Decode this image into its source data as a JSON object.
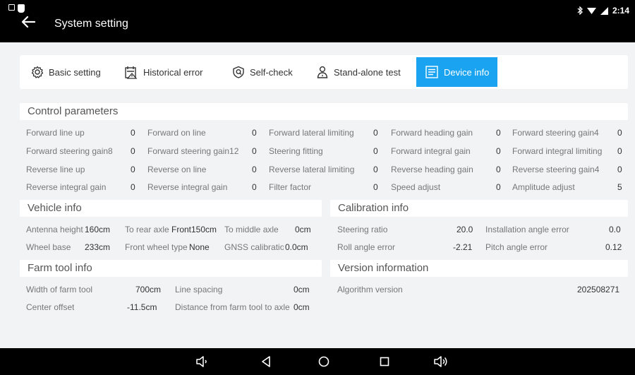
{
  "header": {
    "title": "System setting"
  },
  "status": {
    "time": "2:14"
  },
  "tabs": [
    {
      "label": "Basic setting",
      "icon": "gear-icon"
    },
    {
      "label": "Historical error",
      "icon": "error-history-icon"
    },
    {
      "label": "Self-check",
      "icon": "self-check-icon"
    },
    {
      "label": "Stand-alone test",
      "icon": "person-test-icon"
    },
    {
      "label": "Device info",
      "icon": "device-info-icon",
      "active": true
    }
  ],
  "control": {
    "title": "Control parameters",
    "rows": [
      [
        {
          "label": "Forward line up",
          "value": "0"
        },
        {
          "label": "Forward on line",
          "value": "0"
        },
        {
          "label": "Forward lateral limiting",
          "value": "0"
        },
        {
          "label": "Forward heading gain",
          "value": "0"
        },
        {
          "label": "Forward steering gain4",
          "value": "0"
        }
      ],
      [
        {
          "label": "Forward steering gain8",
          "value": "0"
        },
        {
          "label": "Forward steering gain12",
          "value": "0"
        },
        {
          "label": "Steering fitting",
          "value": "0"
        },
        {
          "label": "Forward integral gain",
          "value": "0"
        },
        {
          "label": "Forward integral limiting",
          "value": "0"
        }
      ],
      [
        {
          "label": "Reverse line up",
          "value": "0"
        },
        {
          "label": "Reverse on line",
          "value": "0"
        },
        {
          "label": "Reverse lateral limiting",
          "value": "0"
        },
        {
          "label": "Reverse heading gain",
          "value": "0"
        },
        {
          "label": "Reverse steering gain4",
          "value": "0"
        }
      ],
      [
        {
          "label": "Reverse integral gain",
          "value": "0"
        },
        {
          "label": "Reverse integral gain",
          "value": "0"
        },
        {
          "label": "Filter factor",
          "value": "0"
        },
        {
          "label": "Speed adjust",
          "value": "0"
        },
        {
          "label": "Amplitude adjust",
          "value": "5"
        }
      ]
    ]
  },
  "vehicle": {
    "title": "Vehicle info",
    "rows": [
      [
        {
          "label": "Antenna height",
          "value": "160cm"
        },
        {
          "label": "To rear axle",
          "value": "Front150cm"
        },
        {
          "label": "To middle axle",
          "value": "0cm"
        }
      ],
      [
        {
          "label": "Wheel base",
          "value": "233cm"
        },
        {
          "label": "Front wheel type",
          "value": "None"
        },
        {
          "label": "GNSS calibration",
          "value": "0.0cm"
        }
      ]
    ]
  },
  "calibration": {
    "title": "Calibration info",
    "rows": [
      [
        {
          "label": "Steering ratio",
          "value": "20.0"
        },
        {
          "label": "Installation angle error",
          "value": "0.0"
        }
      ],
      [
        {
          "label": "Roll angle error",
          "value": "-2.21"
        },
        {
          "label": "Pitch angle error",
          "value": "0.12"
        }
      ]
    ]
  },
  "farmtool": {
    "title": "Farm tool info",
    "rows": [
      [
        {
          "label": "Width of farm tool",
          "value": "700cm"
        },
        {
          "label": "Line spacing",
          "value": "0cm"
        }
      ],
      [
        {
          "label": "Center offset",
          "value": "-11.5cm"
        },
        {
          "label": "Distance from farm tool to axle",
          "value": "0cm"
        }
      ]
    ]
  },
  "version": {
    "title": "Version information",
    "rows": [
      [
        {
          "label": "Algorithm version",
          "value": "202508271"
        }
      ]
    ]
  },
  "colors": {
    "accent": "#1aa3f0",
    "topbar": "#000000",
    "background": "#f2f3f5"
  },
  "navbar": {
    "icons": [
      "volume-down-icon",
      "back-triangle-icon",
      "home-circle-icon",
      "recents-square-icon",
      "volume-up-icon"
    ]
  }
}
